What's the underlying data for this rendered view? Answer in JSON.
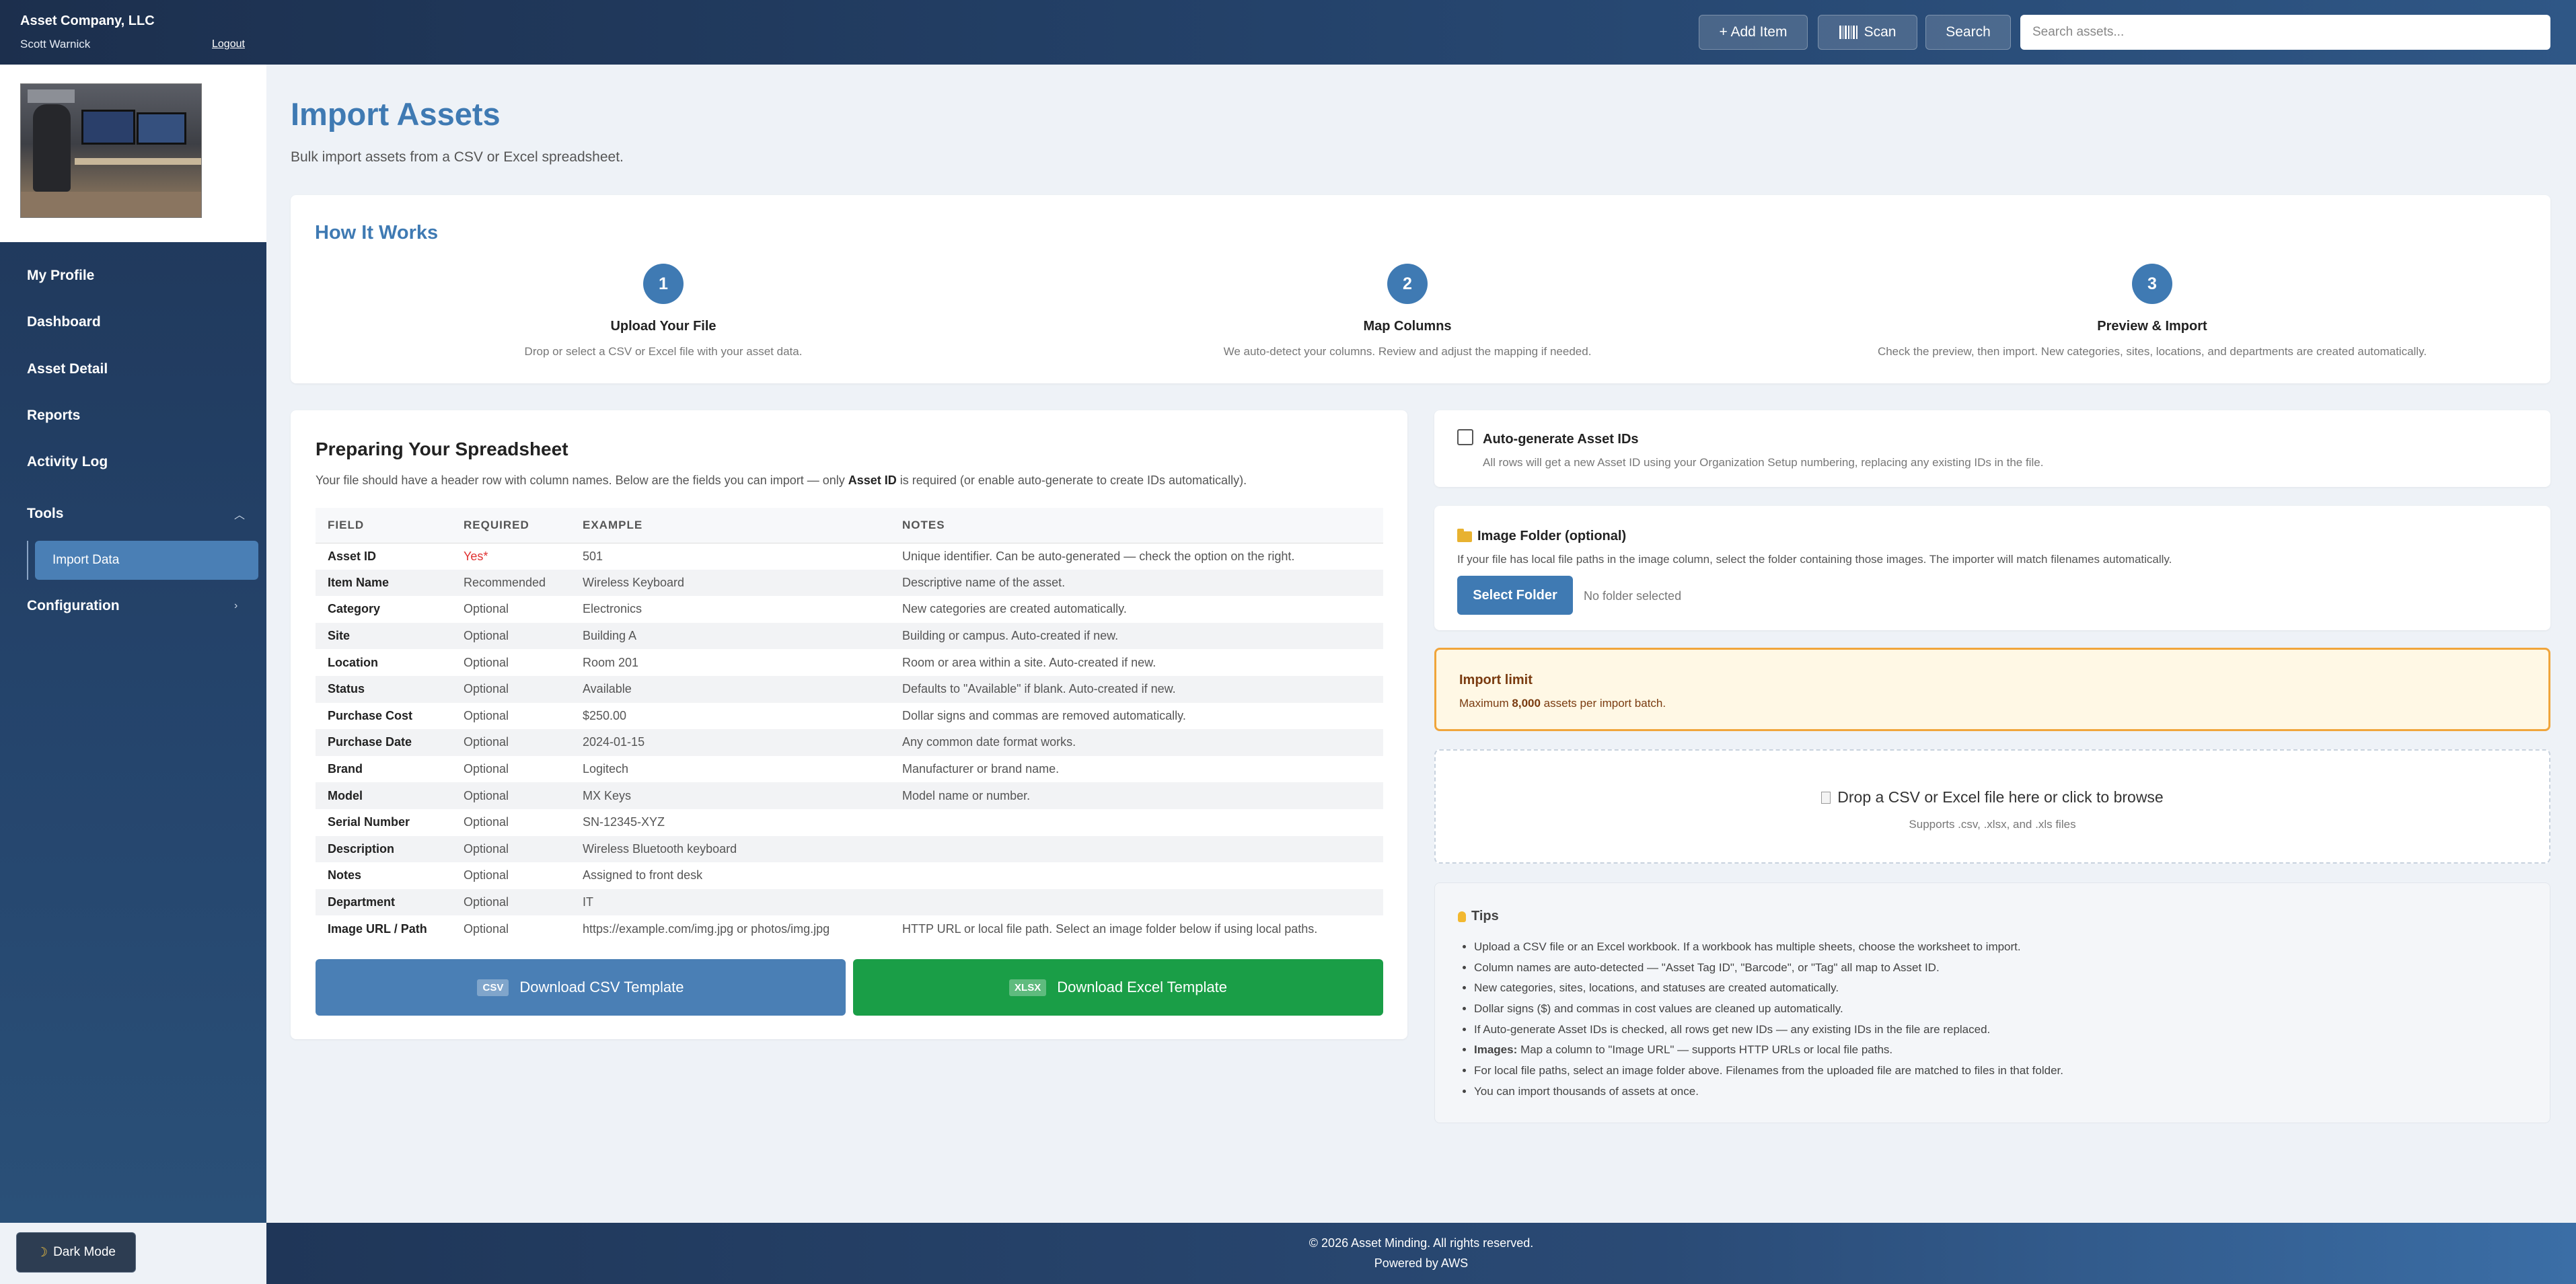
{
  "header": {
    "company": "Asset Company, LLC",
    "user": "Scott Warnick",
    "logout": "Logout",
    "add_item": "+ Add Item",
    "scan": "Scan",
    "search_button": "Search",
    "search_placeholder": "Search assets..."
  },
  "sidebar": {
    "items": [
      {
        "label": "My Profile"
      },
      {
        "label": "Dashboard"
      },
      {
        "label": "Asset Detail"
      },
      {
        "label": "Reports"
      },
      {
        "label": "Activity Log"
      },
      {
        "label": "Tools"
      },
      {
        "label": "Configuration"
      }
    ],
    "subitem_active": "Import Data",
    "dark_mode": "Dark Mode"
  },
  "page": {
    "title": "Import Assets",
    "subtitle": "Bulk import assets from a CSV or Excel spreadsheet."
  },
  "how": {
    "title": "How It Works",
    "steps": [
      {
        "num": "1",
        "title": "Upload Your File",
        "desc": "Drop or select a CSV or Excel file with your asset data."
      },
      {
        "num": "2",
        "title": "Map Columns",
        "desc": "We auto-detect your columns. Review and adjust the mapping if needed."
      },
      {
        "num": "3",
        "title": "Preview & Import",
        "desc": "Check the preview, then import. New categories, sites, locations, and departments are created automatically."
      }
    ]
  },
  "prep": {
    "title": "Preparing Your Spreadsheet",
    "desc_pre": "Your file should have a header row with column names. Below are the fields you can import — only ",
    "desc_bold": "Asset ID",
    "desc_post": " is required (or enable auto-generate to create IDs automatically).",
    "headers": [
      "FIELD",
      "REQUIRED",
      "EXAMPLE",
      "NOTES"
    ],
    "rows": [
      [
        "Asset ID",
        "Yes*",
        "501",
        "Unique identifier. Can be auto-generated — check the option on the right."
      ],
      [
        "Item Name",
        "Recommended",
        "Wireless Keyboard",
        "Descriptive name of the asset."
      ],
      [
        "Category",
        "Optional",
        "Electronics",
        "New categories are created automatically."
      ],
      [
        "Site",
        "Optional",
        "Building A",
        "Building or campus. Auto-created if new."
      ],
      [
        "Location",
        "Optional",
        "Room 201",
        "Room or area within a site. Auto-created if new."
      ],
      [
        "Status",
        "Optional",
        "Available",
        "Defaults to \"Available\" if blank. Auto-created if new."
      ],
      [
        "Purchase Cost",
        "Optional",
        "$250.00",
        "Dollar signs and commas are removed automatically."
      ],
      [
        "Purchase Date",
        "Optional",
        "2024-01-15",
        "Any common date format works."
      ],
      [
        "Brand",
        "Optional",
        "Logitech",
        "Manufacturer or brand name."
      ],
      [
        "Model",
        "Optional",
        "MX Keys",
        "Model name or number."
      ],
      [
        "Serial Number",
        "Optional",
        "SN-12345-XYZ",
        ""
      ],
      [
        "Description",
        "Optional",
        "Wireless Bluetooth keyboard",
        ""
      ],
      [
        "Notes",
        "Optional",
        "Assigned to front desk",
        ""
      ],
      [
        "Department",
        "Optional",
        "IT",
        ""
      ],
      [
        "Image URL / Path",
        "Optional",
        "https://example.com/img.jpg or photos/img.jpg",
        "HTTP URL or local file path. Select an image folder below if using local paths."
      ]
    ],
    "csv_badge": "CSV",
    "csv_label": "Download CSV Template",
    "xlsx_badge": "XLSX",
    "xlsx_label": "Download Excel Template"
  },
  "auto": {
    "title": "Auto-generate Asset IDs",
    "desc": "All rows will get a new Asset ID using your Organization Setup numbering, replacing any existing IDs in the file."
  },
  "image_folder": {
    "title": "Image Folder (optional)",
    "desc": "If your file has local file paths in the image column, select the folder containing those images. The importer will match filenames automatically.",
    "button": "Select Folder",
    "status": "No folder selected"
  },
  "limit": {
    "title": "Import limit",
    "pre": "Maximum ",
    "value": "8,000",
    "post": " assets per import batch."
  },
  "drop": {
    "title": "Drop a CSV or Excel file here or click to browse",
    "sub": "Supports .csv, .xlsx, and .xls files"
  },
  "tips": {
    "title": "Tips",
    "items": [
      "Upload a CSV file or an Excel workbook. If a workbook has multiple sheets, choose the worksheet to import.",
      "Column names are auto-detected — \"Asset Tag ID\", \"Barcode\", or \"Tag\" all map to Asset ID.",
      "New categories, sites, locations, and statuses are created automatically.",
      "Dollar signs ($) and commas in cost values are cleaned up automatically.",
      "If Auto-generate Asset IDs is checked, all rows get new IDs — any existing IDs in the file are replaced.",
      "Map a column to \"Image URL\" — supports HTTP URLs or local file paths.",
      "For local file paths, select an image folder above. Filenames from the uploaded file are matched to files in that folder.",
      "You can import thousands of assets at once."
    ],
    "images_bold": "Images:"
  },
  "footer": {
    "copyright": "© 2026 Asset Minding. All rights reserved.",
    "powered": "Powered by AWS"
  }
}
